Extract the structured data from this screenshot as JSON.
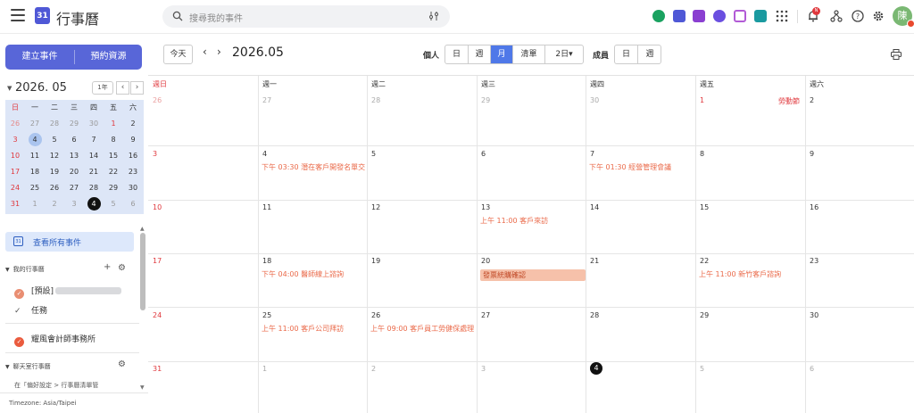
{
  "app": {
    "title": "行事曆",
    "logo_text": "31"
  },
  "search": {
    "placeholder": "搜尋我的事件"
  },
  "header_icons": [
    "chat-icon",
    "calendar-app-icon",
    "notes-icon",
    "moon-icon",
    "clipboard-icon",
    "contacts-icon",
    "apps-grid-icon",
    "bell-icon",
    "network-icon",
    "help-icon",
    "settings-icon"
  ],
  "notification_count": "N",
  "avatar": {
    "initial": "陳"
  },
  "sidebar": {
    "create_event": "建立事件",
    "book_resource": "預約資源",
    "mini_month": "2026. 05",
    "year_button": "1年",
    "weekdays": [
      "日",
      "一",
      "二",
      "三",
      "四",
      "五",
      "六"
    ],
    "weeks": [
      [
        "26",
        "27",
        "28",
        "29",
        "30",
        "1",
        "2"
      ],
      [
        "3",
        "4",
        "5",
        "6",
        "7",
        "8",
        "9"
      ],
      [
        "10",
        "11",
        "12",
        "13",
        "14",
        "15",
        "16"
      ],
      [
        "17",
        "18",
        "19",
        "20",
        "21",
        "22",
        "23"
      ],
      [
        "24",
        "25",
        "26",
        "27",
        "28",
        "29",
        "30"
      ],
      [
        "31",
        "1",
        "2",
        "3",
        "4",
        "5",
        "6"
      ]
    ],
    "view_all_events": "查看所有事件",
    "my_calendars": "我的行事曆",
    "default_calendar": "[預設]",
    "tasks": "任務",
    "firm_calendar": "耀風會計師事務所",
    "chatroom_calendars": "聊天室行事曆",
    "hint": "在「偏好設定 > 行事曆清單管",
    "timezone": "Timezone: Asia/Taipei"
  },
  "toolbar": {
    "today": "今天",
    "current_month": "2026.05",
    "personal_label": "個人",
    "views": [
      "日",
      "週",
      "月",
      "清單",
      "2日▾"
    ],
    "active_view": "月",
    "member_label": "成員",
    "member_views": [
      "日",
      "週"
    ]
  },
  "grid": {
    "weekday_headers": [
      "週日",
      "週一",
      "週二",
      "週三",
      "週四",
      "週五",
      "週六"
    ],
    "weeks": [
      [
        "26",
        "27",
        "28",
        "29",
        "30",
        "1",
        "2"
      ],
      [
        "3",
        "4",
        "5",
        "6",
        "7",
        "8",
        "9"
      ],
      [
        "10",
        "11",
        "12",
        "13",
        "14",
        "15",
        "16"
      ],
      [
        "17",
        "18",
        "19",
        "20",
        "21",
        "22",
        "23"
      ],
      [
        "24",
        "25",
        "26",
        "27",
        "28",
        "29",
        "30"
      ],
      [
        "31",
        "1",
        "2",
        "3",
        "4",
        "5",
        "6"
      ]
    ],
    "holiday": "勞動節",
    "events": [
      {
        "text": "下午 03:30 潛在客戶開發名單交"
      },
      {
        "text": "下午 01:30 經營管理會議"
      },
      {
        "text": "上午 11:00 客戶來訪"
      },
      {
        "text": "下午 04:00 醫師線上諮詢"
      },
      {
        "text": "發票統購確認"
      },
      {
        "text": "上午 11:00 新竹客戶諮詢"
      },
      {
        "text": "上午 11:00 客戶公司拜訪"
      },
      {
        "text": "上午 09:00 客戶員工勞健保處理"
      }
    ]
  },
  "colors": {
    "accent": "#5866d8",
    "active_view": "#4f78e8",
    "holiday": "#e0383d",
    "event": "#ea6a4a"
  }
}
